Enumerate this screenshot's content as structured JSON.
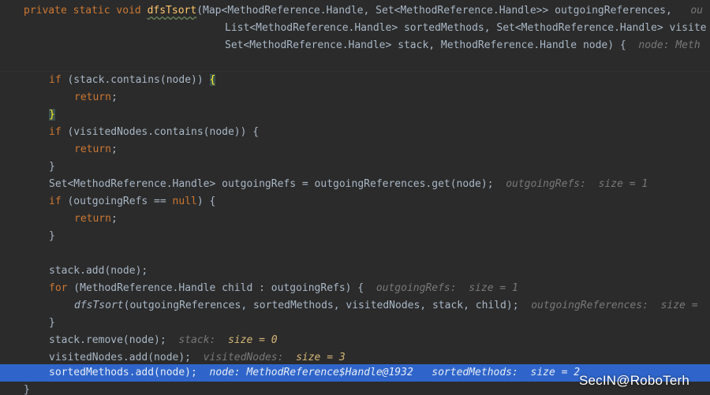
{
  "editor": {
    "lines": {
      "l1": {
        "kw1": "private",
        "kw2": "static",
        "kw3": "void",
        "fn": "dfsTsort",
        "params": "(Map<MethodReference.Handle, Set<MethodReference.Handle>> outgoingReferences,",
        "hint": "ou"
      },
      "l2": {
        "text": "List<MethodReference.Handle> sortedMethods, Set<MethodReference.Handle> visite"
      },
      "l3": {
        "text": "Set<MethodReference.Handle> stack, MethodReference.Handle node) {",
        "hint": "node: Meth"
      },
      "l5": {
        "kw": "if",
        "text": " (stack.contains(node)) ",
        "brace": "{"
      },
      "l6": {
        "kw": "return",
        "text": ";"
      },
      "l7": {
        "brace": "}"
      },
      "l8": {
        "kw": "if",
        "text": " (visitedNodes.contains(node)) {"
      },
      "l9": {
        "kw": "return",
        "text": ";"
      },
      "l10": {
        "text": "}"
      },
      "l11": {
        "text": "Set<MethodReference.Handle> outgoingRefs = outgoingReferences.get(node);",
        "hint_name": "outgoingRefs:",
        "hint_val": "size = 1"
      },
      "l12": {
        "kw": "if",
        "text1": " (outgoingRefs == ",
        "kw2": "null",
        "text2": ") {"
      },
      "l13": {
        "kw": "return",
        "text": ";"
      },
      "l14": {
        "text": "}"
      },
      "l16": {
        "text": "stack.add(node);"
      },
      "l17": {
        "kw": "for",
        "text": " (MethodReference.Handle child : outgoingRefs) {",
        "hint_name": "outgoingRefs:",
        "hint_val": "size = 1"
      },
      "l18": {
        "fn": "dfsTsort",
        "text": "(outgoingReferences, sortedMethods, visitedNodes, stack, child);",
        "hint_name": "outgoingReferences:",
        "hint_val": "size ="
      },
      "l19": {
        "text": "}"
      },
      "l20": {
        "text": "stack.remove(node);",
        "hint_name": "stack:",
        "hint_val": "size = 0"
      },
      "l21": {
        "text": "visitedNodes.add(node);",
        "hint_name": "visitedNodes:",
        "hint_val": "size = 3"
      },
      "l22": {
        "text": "sortedMethods.add(node);",
        "hint1": "node: MethodReference$Handle@1932",
        "hint2_name": "sortedMethods:",
        "hint2_val": "size = 2"
      },
      "l23": {
        "text": "}"
      }
    }
  },
  "watermark": {
    "text": "SecIN@RoboTerh"
  },
  "colors": {
    "background": "#2b2b2b",
    "keyword": "#cc7832",
    "function_decl": "#ffc66d",
    "default_text": "#a9b7c6",
    "inlay_hint": "#787878",
    "changed_hint": "#d5b778",
    "execution_line": "#2f65ca"
  }
}
